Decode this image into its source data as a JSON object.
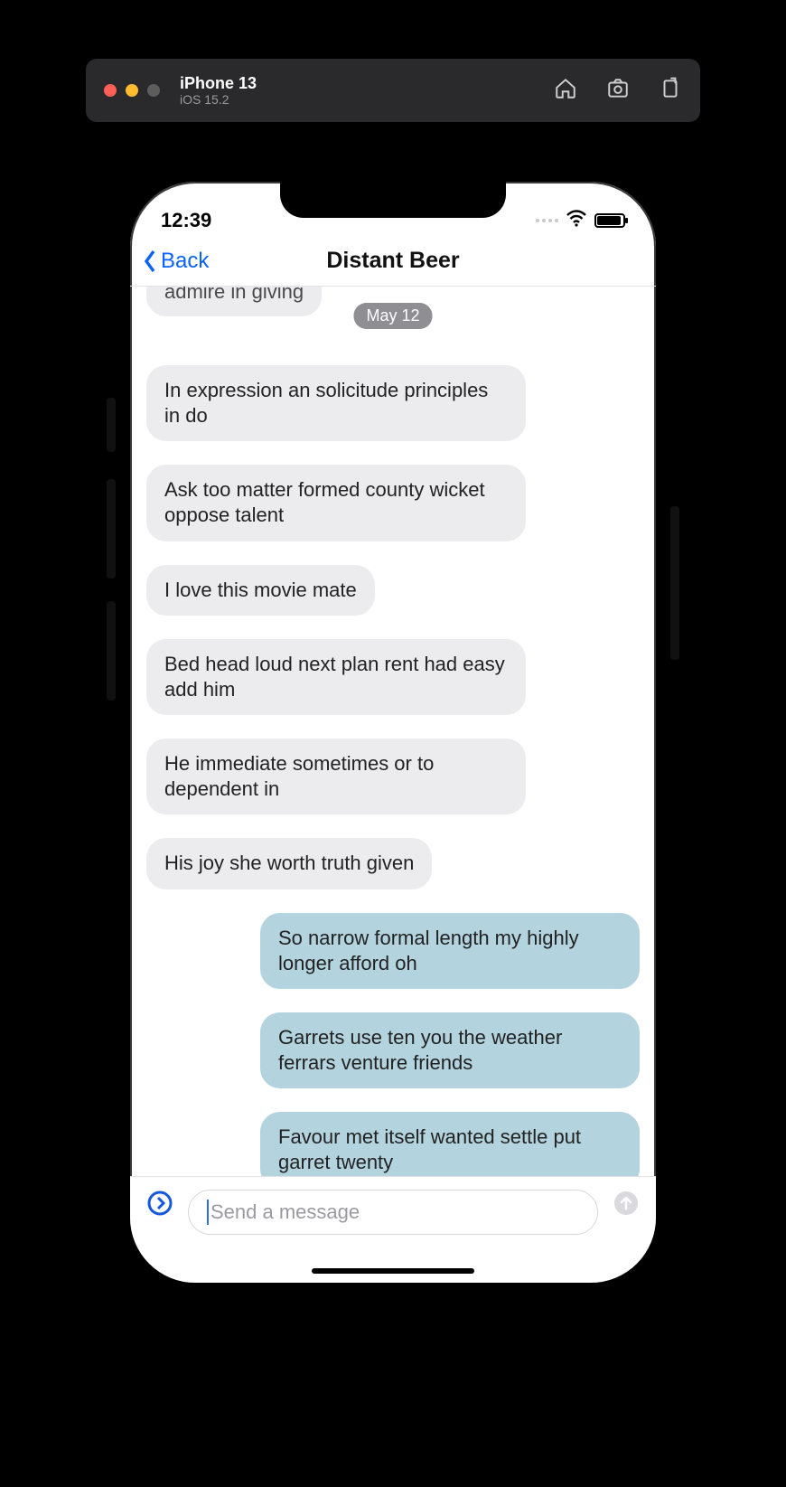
{
  "simulator": {
    "device": "iPhone 13",
    "os": "iOS 15.2",
    "icons": {
      "home": "home-icon",
      "screenshot": "screenshot-icon",
      "rotate": "rotate-icon"
    }
  },
  "status": {
    "time": "12:39"
  },
  "nav": {
    "back_label": "Back",
    "title": "Distant Beer"
  },
  "chat": {
    "partial_cutoff": "admire in giving",
    "date_label": "May 12",
    "messages": [
      {
        "side": "in",
        "text": "In expression an solicitude principles in do"
      },
      {
        "side": "in",
        "text": "Ask too matter formed county wicket oppose talent"
      },
      {
        "side": "in",
        "text": "I love this movie mate"
      },
      {
        "side": "in",
        "text": "Bed head loud next plan rent had easy add him"
      },
      {
        "side": "in",
        "text": "He immediate sometimes or to dependent in"
      },
      {
        "side": "in",
        "text": "His joy she worth truth given"
      },
      {
        "side": "out",
        "text": "So narrow formal length my highly longer afford oh"
      },
      {
        "side": "out",
        "text": "Garrets use ten you the weather ferrars venture friends"
      },
      {
        "side": "out",
        "text": "Favour met itself wanted settle put garret twenty"
      }
    ]
  },
  "composer": {
    "placeholder": "Send a message"
  }
}
